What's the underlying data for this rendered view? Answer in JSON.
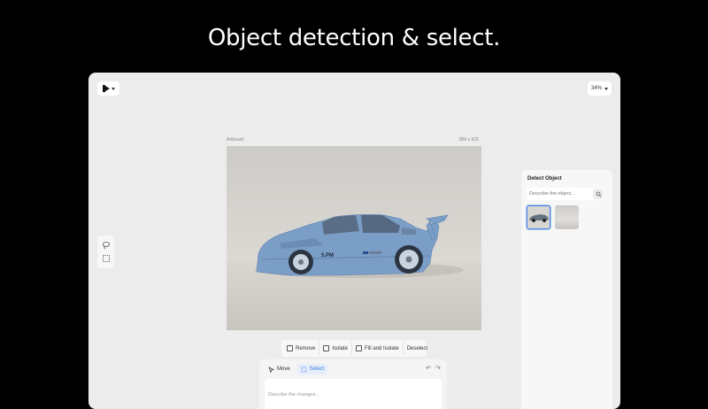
{
  "hero": {
    "title": "Object detection & select."
  },
  "header": {
    "zoom": "34%"
  },
  "artboard": {
    "label": "Artboard",
    "size": "866 x 625"
  },
  "actions": {
    "remove": "Remove",
    "isolate": "Isolate",
    "fill_isolate": "Fill and Isolate",
    "deselect": "Deselect"
  },
  "prompt": {
    "modes": {
      "move": "Move",
      "select": "Select"
    },
    "placeholder": "Describe the changes..."
  },
  "detect": {
    "title": "Detect Object",
    "placeholder": "Describe the object..."
  },
  "icons": [
    "logo-icon",
    "lasso-icon",
    "marquee-select-icon",
    "remove-icon",
    "isolate-icon",
    "fill-isolate-icon",
    "move-icon",
    "select-icon",
    "undo-icon",
    "redo-icon",
    "search-icon"
  ],
  "colors": {
    "selection_overlay": "#7b9ec7",
    "accent": "#3a78d8"
  }
}
